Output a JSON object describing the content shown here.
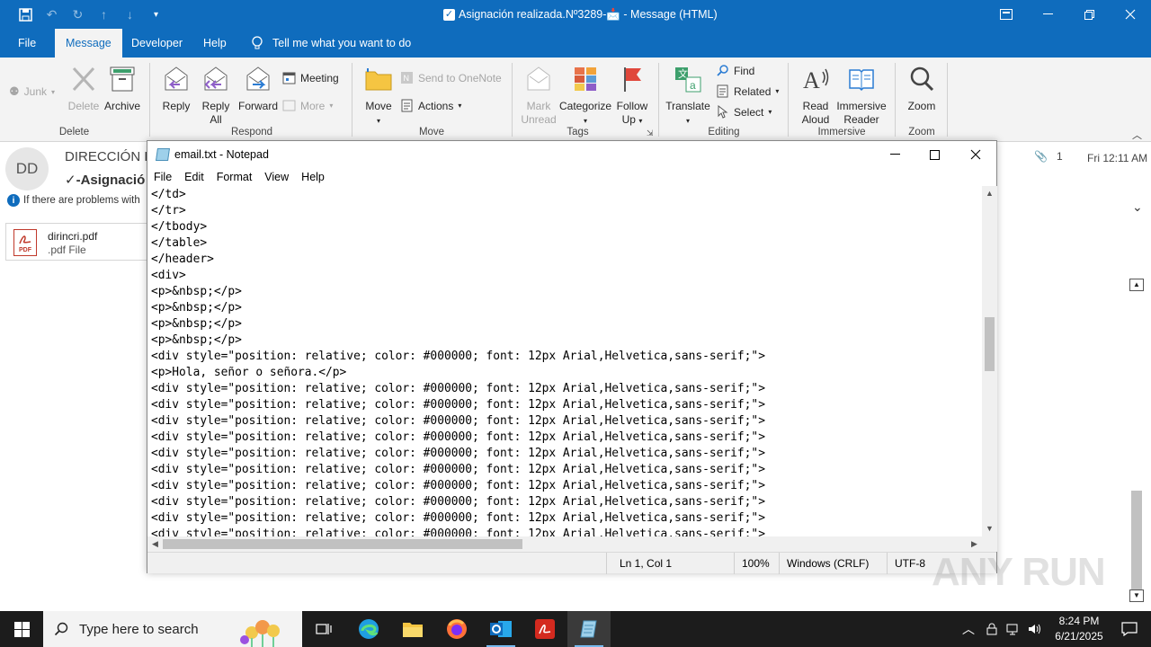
{
  "outlook": {
    "window_title": "Asignación realizada.Nº3289-📩  -  Message (HTML)",
    "tabs": {
      "file": "File",
      "message": "Message",
      "developer": "Developer",
      "help": "Help",
      "tell_me": "Tell me what you want to do"
    },
    "ribbon": {
      "junk": "Junk",
      "delete": "Delete",
      "archive": "Archive",
      "group_delete": "Delete",
      "reply": "Reply",
      "reply_all_1": "Reply",
      "reply_all_2": "All",
      "forward": "Forward",
      "meeting": "Meeting",
      "more": "More",
      "group_respond": "Respond",
      "move": "Move",
      "send_to_onenote": "Send to OneNote",
      "actions": "Actions",
      "group_move": "Move",
      "mark_unread_1": "Mark",
      "mark_unread_2": "Unread",
      "categorize": "Categorize",
      "follow_up_1": "Follow",
      "follow_up_2": "Up",
      "group_tags": "Tags",
      "translate": "Translate",
      "find": "Find",
      "related": "Related",
      "select": "Select",
      "group_editing": "Editing",
      "read_aloud_1": "Read",
      "read_aloud_2": "Aloud",
      "immersive_1": "Immersive",
      "immersive_2": "Reader",
      "group_immersive": "Immersive",
      "zoom": "Zoom",
      "group_zoom": "Zoom"
    },
    "message": {
      "avatar_initials": "DD",
      "sender": "DIRECCIÓN D",
      "subject": "-Asignació",
      "info_bar": "If there are problems with",
      "attachment_name": "dirincri.pdf",
      "attachment_type": ".pdf File",
      "attachment_count": "1",
      "date": "Fri 12:11 AM"
    }
  },
  "notepad": {
    "title": "email.txt - Notepad",
    "menu": [
      "File",
      "Edit",
      "Format",
      "View",
      "Help"
    ],
    "lines": [
      "</td>",
      "</tr>",
      "</tbody>",
      "</table>",
      "</header>",
      "<div>",
      "<p>&nbsp;</p>",
      "<p>&nbsp;</p>",
      "<p>&nbsp;</p>",
      "<p>&nbsp;</p>",
      "<div style=\"position: relative; color: #000000; font: 12px Arial,Helvetica,sans-serif;\">",
      "<p>Hola, señor o señora.</p>",
      "<div style=\"position: relative; color: #000000; font: 12px Arial,Helvetica,sans-serif;\">",
      "<div style=\"position: relative; color: #000000; font: 12px Arial,Helvetica,sans-serif;\">",
      "<div style=\"position: relative; color: #000000; font: 12px Arial,Helvetica,sans-serif;\">",
      "<div style=\"position: relative; color: #000000; font: 12px Arial,Helvetica,sans-serif;\">",
      "<div style=\"position: relative; color: #000000; font: 12px Arial,Helvetica,sans-serif;\">",
      "<div style=\"position: relative; color: #000000; font: 12px Arial,Helvetica,sans-serif;\">",
      "<div style=\"position: relative; color: #000000; font: 12px Arial,Helvetica,sans-serif;\">",
      "<div style=\"position: relative; color: #000000; font: 12px Arial,Helvetica,sans-serif;\">",
      "<div style=\"position: relative; color: #000000; font: 12px Arial,Helvetica,sans-serif;\">",
      "<div style=\"position: relative; color: #000000; font: 12px Arial,Helvetica,sans-serif;\">"
    ],
    "status": {
      "position": "Ln 1, Col 1",
      "zoom": "100%",
      "line_ending": "Windows (CRLF)",
      "encoding": "UTF-8"
    }
  },
  "taskbar": {
    "search_placeholder": "Type here to search",
    "time": "8:24 PM",
    "date": "6/21/2025"
  },
  "watermark": "ANY RUN",
  "colors": {
    "outlook_blue": "#0f6cbd",
    "ribbon_bg": "#f3f3f3",
    "taskbar_bg": "#1c1c1c"
  }
}
